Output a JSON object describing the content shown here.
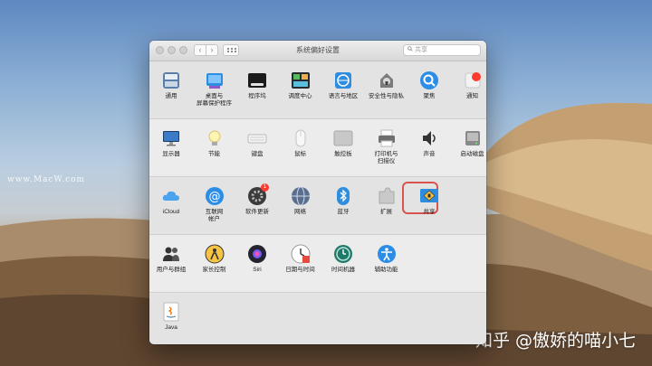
{
  "window": {
    "title": "系统偏好设置",
    "search_placeholder": "共享",
    "nav_back": "‹",
    "nav_forward": "›"
  },
  "rows": [
    [
      {
        "label": "通用",
        "icon": "general-icon"
      },
      {
        "label": "桌面与\n屏幕保护程序",
        "icon": "desktop-screensaver-icon"
      },
      {
        "label": "程序坞",
        "icon": "dock-icon"
      },
      {
        "label": "调度中心",
        "icon": "mission-control-icon"
      },
      {
        "label": "语言与地区",
        "icon": "language-region-icon"
      },
      {
        "label": "安全性与隐私",
        "icon": "security-privacy-icon"
      },
      {
        "label": "聚焦",
        "icon": "spotlight-icon"
      },
      {
        "label": "通知",
        "icon": "notifications-icon"
      }
    ],
    [
      {
        "label": "显示器",
        "icon": "displays-icon"
      },
      {
        "label": "节能",
        "icon": "energy-saver-icon"
      },
      {
        "label": "键盘",
        "icon": "keyboard-icon"
      },
      {
        "label": "鼠标",
        "icon": "mouse-icon"
      },
      {
        "label": "触控板",
        "icon": "trackpad-icon"
      },
      {
        "label": "打印机与\n扫描仪",
        "icon": "printers-scanners-icon"
      },
      {
        "label": "声音",
        "icon": "sound-icon"
      },
      {
        "label": "启动磁盘",
        "icon": "startup-disk-icon"
      }
    ],
    [
      {
        "label": "iCloud",
        "icon": "icloud-icon"
      },
      {
        "label": "互联网\n帐户",
        "icon": "internet-accounts-icon"
      },
      {
        "label": "软件更新",
        "icon": "software-update-icon",
        "badge": "1"
      },
      {
        "label": "网络",
        "icon": "network-icon"
      },
      {
        "label": "蓝牙",
        "icon": "bluetooth-icon"
      },
      {
        "label": "扩展",
        "icon": "extensions-icon"
      },
      {
        "label": "共享",
        "icon": "sharing-icon",
        "highlighted": true
      }
    ],
    [
      {
        "label": "用户与群组",
        "icon": "users-groups-icon"
      },
      {
        "label": "家长控制",
        "icon": "parental-controls-icon"
      },
      {
        "label": "Siri",
        "icon": "siri-icon"
      },
      {
        "label": "日期与时间",
        "icon": "date-time-icon"
      },
      {
        "label": "时间机器",
        "icon": "time-machine-icon"
      },
      {
        "label": "辅助功能",
        "icon": "accessibility-icon"
      }
    ],
    [
      {
        "label": "Java",
        "icon": "java-icon"
      }
    ]
  ],
  "watermarks": {
    "left": "www.MacW.com",
    "right": "知乎 @傲娇的喵小七"
  },
  "colors": {
    "highlight_border": "#d9534f",
    "window_bg": "#ececec",
    "section_alt_bg": "#e3e3e3"
  }
}
